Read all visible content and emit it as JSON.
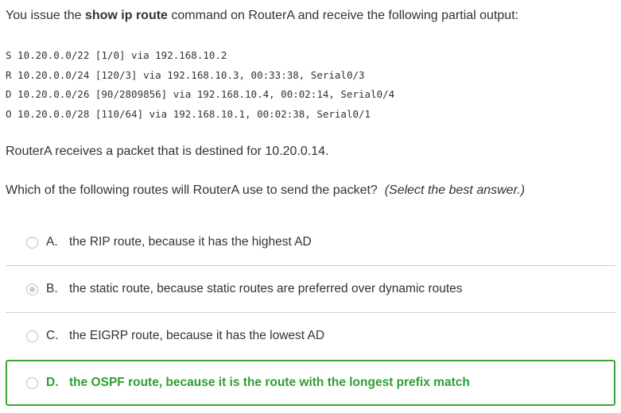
{
  "question": {
    "intro_pre": "You issue the ",
    "intro_cmd": "show ip route",
    "intro_post": " command on RouterA and receive the following partial output:",
    "routes": [
      "S 10.20.0.0/22 [1/0] via 192.168.10.2",
      "R 10.20.0.0/24 [120/3] via 192.168.10.3, 00:33:38, Serial0/3",
      "D 10.20.0.0/26 [90/2809856] via 192.168.10.4, 00:02:14, Serial0/4",
      "O 10.20.0.0/28 [110/64] via 192.168.10.1, 00:02:38, Serial0/1"
    ],
    "packet_text": "RouterA receives a packet that is destined for 10.20.0.14.",
    "prompt": "Which of the following routes will RouterA use to send the packet?",
    "instruction": "(Select the best answer.)"
  },
  "options": [
    {
      "letter": "A.",
      "text": "the RIP route, because it has the highest AD",
      "selected": false,
      "correct": false
    },
    {
      "letter": "B.",
      "text": "the static route, because static routes are preferred over dynamic routes",
      "selected": true,
      "correct": false
    },
    {
      "letter": "C.",
      "text": "the EIGRP route, because it has the lowest AD",
      "selected": false,
      "correct": false
    },
    {
      "letter": "D.",
      "text": "the OSPF route, because it is the route with the longest prefix match",
      "selected": false,
      "correct": true
    }
  ],
  "colors": {
    "correct": "#2f9e2f",
    "text": "#333333",
    "separator": "#cfcfcf"
  }
}
